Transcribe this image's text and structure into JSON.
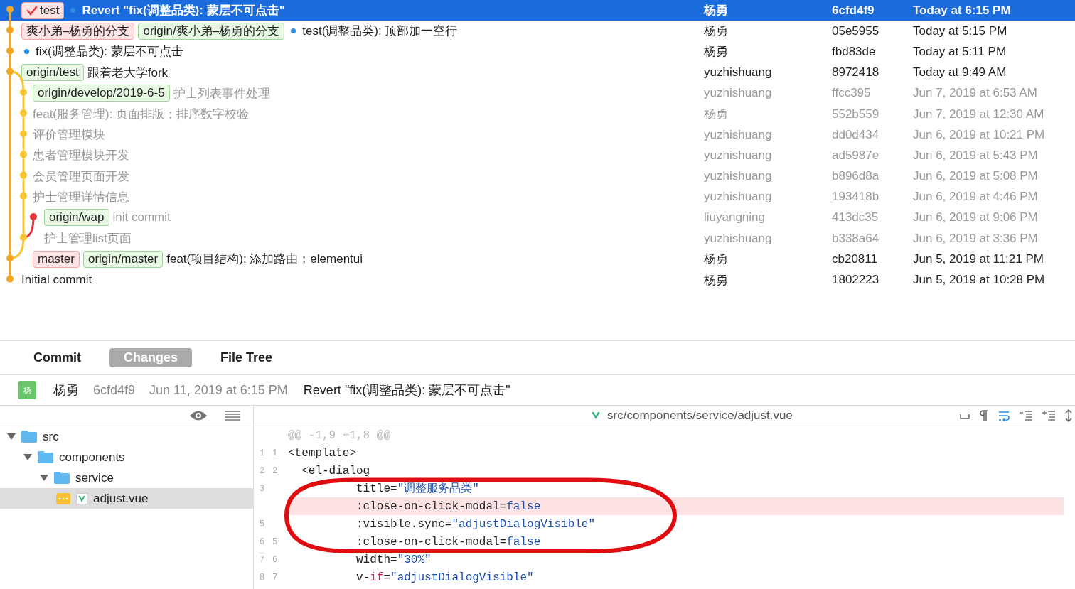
{
  "commits": [
    {
      "refs": [
        {
          "label": "test",
          "kind": "local",
          "current": true
        }
      ],
      "marked": true,
      "message": "Revert \"fix(调整品类): 蒙层不可点击\"",
      "author": "杨勇",
      "hash": "6cfd4f9",
      "date": "Today at 6:15 PM",
      "selected": true,
      "faded": false,
      "color": "#f5a623"
    },
    {
      "refs": [
        {
          "label": "爽小弟–杨勇的分支",
          "kind": "local",
          "current": false
        },
        {
          "label": "origin/爽小弟–杨勇的分支",
          "kind": "remote",
          "current": false
        }
      ],
      "marked": true,
      "message": "test(调整品类): 顶部加一空行",
      "author": "杨勇",
      "hash": "05e5955",
      "date": "Today at 5:15 PM",
      "selected": false,
      "faded": false,
      "color": "#f5a623"
    },
    {
      "marked": true,
      "message": "fix(调整品类): 蒙层不可点击",
      "author": "杨勇",
      "hash": "fbd83de",
      "date": "Today at 5:11 PM",
      "selected": false,
      "faded": false,
      "color": "#f5a623"
    },
    {
      "refs": [
        {
          "label": "origin/test",
          "kind": "remote",
          "current": false
        }
      ],
      "marked": false,
      "message": "跟着老大学fork",
      "author": "yuzhishuang",
      "hash": "8972418",
      "date": "Today at 9:49 AM",
      "selected": false,
      "faded": false,
      "color": "#f5a623"
    },
    {
      "refs": [
        {
          "label": "origin/develop/2019-6-5",
          "kind": "remote",
          "current": false
        }
      ],
      "marked": false,
      "message": "护士列表事件处理",
      "author": "yuzhishuang",
      "hash": "ffcc395",
      "date": "Jun 7, 2019 at 6:53 AM",
      "selected": false,
      "faded": true,
      "color": "#f7c531"
    },
    {
      "marked": false,
      "message": "feat(服务管理): 页面排版；排序数字校验",
      "author": "杨勇",
      "hash": "552b559",
      "date": "Jun 7, 2019 at 12:30 AM",
      "selected": false,
      "faded": true,
      "color": "#f7c531"
    },
    {
      "marked": false,
      "message": "评价管理模块",
      "author": "yuzhishuang",
      "hash": "dd0d434",
      "date": "Jun 6, 2019 at 10:21 PM",
      "selected": false,
      "faded": true,
      "color": "#f7c531"
    },
    {
      "marked": false,
      "message": "患者管理模块开发",
      "author": "yuzhishuang",
      "hash": "ad5987e",
      "date": "Jun 6, 2019 at 5:43 PM",
      "selected": false,
      "faded": true,
      "color": "#f7c531"
    },
    {
      "marked": false,
      "message": "会员管理页面开发",
      "author": "yuzhishuang",
      "hash": "b896d8a",
      "date": "Jun 6, 2019 at 5:08 PM",
      "selected": false,
      "faded": true,
      "color": "#f7c531"
    },
    {
      "marked": false,
      "message": "护士管理详情信息",
      "author": "yuzhishuang",
      "hash": "193418b",
      "date": "Jun 6, 2019 at 4:46 PM",
      "selected": false,
      "faded": true,
      "color": "#f7c531"
    },
    {
      "refs": [
        {
          "label": "origin/wap",
          "kind": "remote",
          "current": false
        }
      ],
      "marked": false,
      "message": "init commit",
      "author": "liuyangning",
      "hash": "413dc35",
      "date": "Jun 6, 2019 at 9:06 PM",
      "selected": false,
      "faded": true,
      "color": "#e5393e"
    },
    {
      "marked": false,
      "message": "护士管理list页面",
      "author": "yuzhishuang",
      "hash": "b338a64",
      "date": "Jun 6, 2019 at 3:36 PM",
      "selected": false,
      "faded": true,
      "color": "#f7c531"
    },
    {
      "refs": [
        {
          "label": "master",
          "kind": "local",
          "current": false
        },
        {
          "label": "origin/master",
          "kind": "remote",
          "current": false
        }
      ],
      "marked": false,
      "message": "feat(项目结构): 添加路由；elementui",
      "author": "杨勇",
      "hash": "cb20811",
      "date": "Jun 5, 2019 at 11:21 PM",
      "selected": false,
      "faded": false,
      "color": "#f5a623"
    },
    {
      "marked": false,
      "message": "Initial commit",
      "author": "杨勇",
      "hash": "1802223",
      "date": "Jun 5, 2019 at 10:28 PM",
      "selected": false,
      "faded": false,
      "color": "#f5a623"
    }
  ],
  "tabs": [
    {
      "label": "Commit",
      "selected": false
    },
    {
      "label": "Changes",
      "selected": true
    },
    {
      "label": "File Tree",
      "selected": false
    }
  ],
  "details": {
    "avatar": "杨",
    "author": "杨勇",
    "hash": "6cfd4f9",
    "date": "Jun 11, 2019 at 6:15 PM",
    "message": "Revert \"fix(调整品类): 蒙层不可点击\""
  },
  "file_tree": [
    {
      "name": "src",
      "kind": "folder",
      "expanded": true,
      "selected": false,
      "children": [
        {
          "name": "components",
          "kind": "folder",
          "expanded": true,
          "selected": false,
          "children": [
            {
              "name": "service",
              "kind": "folder",
              "expanded": true,
              "selected": false,
              "children": [
                {
                  "name": "adjust.vue",
                  "kind": "file",
                  "selected": true
                }
              ]
            }
          ]
        }
      ]
    }
  ],
  "diff": {
    "path": "src/components/service/adjust.vue",
    "hunk": "@@ -1,9 +1,8 @@",
    "lines": [
      {
        "old": "1",
        "new": "1",
        "kind": "context",
        "tokens": [
          {
            "t": "<template>",
            "kind": "plain"
          }
        ]
      },
      {
        "old": "2",
        "new": "2",
        "kind": "context",
        "tokens": [
          {
            "t": "  <el-dialog",
            "kind": "plain"
          }
        ]
      },
      {
        "old": "3",
        "kind": "context",
        "tokens": [
          {
            "t": "          title=",
            "kind": "plain"
          },
          {
            "t": "\"调整服务品类\"",
            "kind": "string"
          }
        ]
      },
      {
        "kind": "removed",
        "tokens": [
          {
            "t": "          :close-on-click-modal=",
            "kind": "plain"
          },
          {
            "t": "false",
            "kind": "value"
          }
        ]
      },
      {
        "old": "5",
        "kind": "context",
        "tokens": [
          {
            "t": "          :visible.sync=",
            "kind": "plain"
          },
          {
            "t": "\"adjustDialogVisible\"",
            "kind": "string"
          }
        ]
      },
      {
        "old": "6",
        "new": "5",
        "kind": "context",
        "tokens": [
          {
            "t": "          :close-on-click-modal=",
            "kind": "plain"
          },
          {
            "t": "false",
            "kind": "value"
          }
        ]
      },
      {
        "old": "7",
        "new": "6",
        "kind": "context",
        "tokens": [
          {
            "t": "          width=",
            "kind": "plain"
          },
          {
            "t": "\"30%\"",
            "kind": "string"
          }
        ]
      },
      {
        "old": "8",
        "new": "7",
        "kind": "context",
        "tokens": [
          {
            "t": "          v-",
            "kind": "plain"
          },
          {
            "t": "if",
            "kind": "keyword"
          },
          {
            "t": "=",
            "kind": "plain"
          },
          {
            "t": "\"adjustDialogVisible\"",
            "kind": "string"
          }
        ]
      }
    ]
  }
}
